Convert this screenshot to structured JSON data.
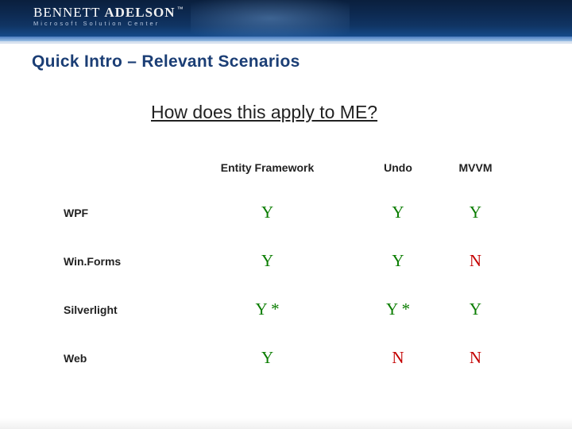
{
  "logo": {
    "name_part1": "BENNETT ",
    "name_part2": "ADELSON",
    "trademark": "™",
    "tagline": "Microsoft Solution Center"
  },
  "title": "Quick Intro – Relevant Scenarios",
  "subtitle": "How does this apply to ME?",
  "columns": [
    "Entity Framework",
    "Undo",
    "MVVM"
  ],
  "rows": [
    {
      "name": "WPF",
      "cells": [
        {
          "text": "Y",
          "cls": "green"
        },
        {
          "text": "Y",
          "cls": "green"
        },
        {
          "text": "Y",
          "cls": "green"
        }
      ]
    },
    {
      "name": "Win.Forms",
      "cells": [
        {
          "text": "Y",
          "cls": "green"
        },
        {
          "text": "Y",
          "cls": "green"
        },
        {
          "text": "N",
          "cls": "red"
        }
      ]
    },
    {
      "name": "Silverlight",
      "cells": [
        {
          "text": "Y *",
          "cls": "green"
        },
        {
          "text": "Y *",
          "cls": "green"
        },
        {
          "text": "Y",
          "cls": "green"
        }
      ]
    },
    {
      "name": "Web",
      "cells": [
        {
          "text": "Y",
          "cls": "green"
        },
        {
          "text": "N",
          "cls": "red"
        },
        {
          "text": "N",
          "cls": "red"
        }
      ]
    }
  ]
}
